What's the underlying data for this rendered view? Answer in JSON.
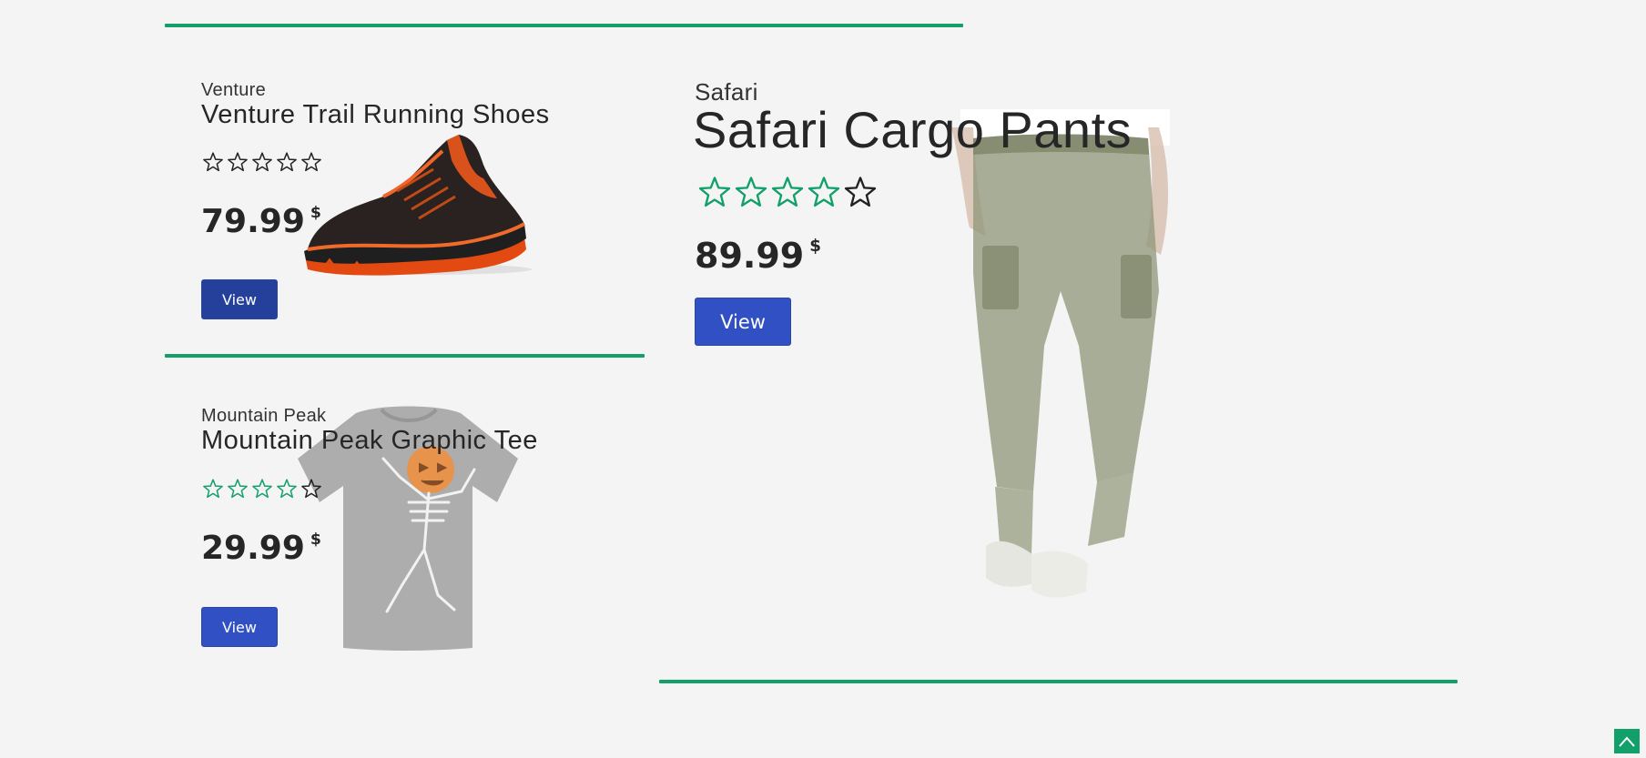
{
  "products": [
    {
      "brand": "Venture",
      "title": "Venture Trail Running Shoes",
      "rating": 0,
      "max_rating": 5,
      "price": "79.99",
      "currency": "$",
      "button_label": "View"
    },
    {
      "brand": "Mountain Peak",
      "title": "Mountain Peak Graphic Tee",
      "rating": 4,
      "max_rating": 5,
      "price": "29.99",
      "currency": "$",
      "button_label": "View"
    },
    {
      "brand": "Safari",
      "title": "Safari Cargo Pants",
      "rating": 4,
      "max_rating": 5,
      "price": "89.99",
      "currency": "$",
      "button_label": "View"
    }
  ],
  "colors": {
    "accent": "#12a06a",
    "star_filled": "#12a06a",
    "star_empty": "#222222",
    "button_primary": "#3050c4",
    "button_active": "#24409b",
    "background": "#f4f4f5"
  },
  "icons": {
    "rating": "star-icon",
    "scroll_top": "chevron-up-icon"
  }
}
